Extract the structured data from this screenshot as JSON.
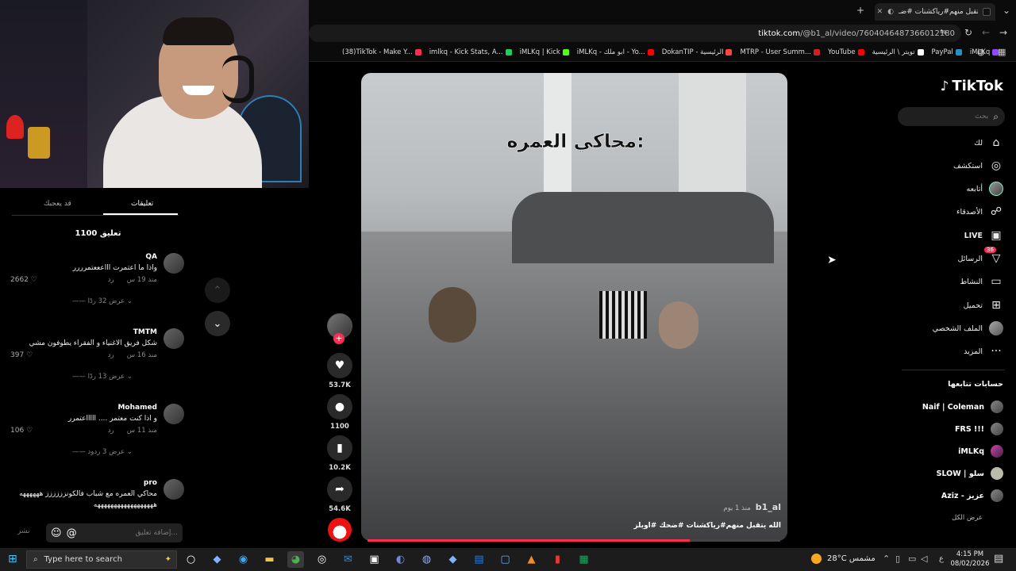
{
  "browser": {
    "tab_title": "الله يتقبل منهم#رياكشنات #ضـ",
    "url_domain": "tiktok.com",
    "url_path": "/@b1_al/video/7604046487366012180",
    "bookmarks": [
      {
        "label": "(38)TikTok - Make Y...",
        "color": "#fe2c55"
      },
      {
        "label": "imlkq - Kick Stats, A...",
        "color": "#1bd15a"
      },
      {
        "label": "iMLKq | Kick",
        "color": "#53fc18"
      },
      {
        "label": "iMLKq - ابو ملك - Yo...",
        "color": "#ff0000"
      },
      {
        "label": "DokanTIP - الرئيسية",
        "color": "#ff4444"
      },
      {
        "label": "MTRP - User Summ...",
        "color": "#cc2222"
      },
      {
        "label": "YouTube",
        "color": "#ff0000"
      },
      {
        "label": "تويتر \\ الرئيسية",
        "color": "#ffffff"
      },
      {
        "label": "PayPal",
        "color": "#2790c3"
      },
      {
        "label": "iMLKq",
        "color": "#9146ff"
      }
    ]
  },
  "comments_panel": {
    "tab_comments": "تعليقات",
    "tab_liked": "قد يعجبك",
    "count_label": "1100 تعليق",
    "comments": [
      {
        "name": "QA",
        "text": "واذا ما اعتمرت اااعععتمرررر",
        "time": "منذ 19 س",
        "reply": "رد",
        "likes": "2662",
        "replies": "عرض 32 ردًا"
      },
      {
        "name": "TMTM",
        "text": "شكل فريق الاغنياء و الفقراء يطوفون مشي",
        "time": "منذ 16 س",
        "reply": "رد",
        "likes": "397",
        "replies": "عرض 13 ردًا"
      },
      {
        "name": "Mohamed",
        "text": "و اذا كنت معتمر .... اااااعتمرر",
        "time": "منذ 11 س",
        "reply": "رد",
        "likes": "106",
        "replies": "عرض 3 ردود"
      },
      {
        "name": "pro",
        "text": "محاكي العمره مع شباب فالكونزززززز ههههههه",
        "text2": "ههههههههههههههههههه",
        "time": "",
        "reply": "",
        "likes": "",
        "replies": ""
      }
    ],
    "input_placeholder": "إضافة تعليق...",
    "post_label": "نشر"
  },
  "video": {
    "overlay_text": "محاكي العمره:",
    "author": "b1_al",
    "posted": "منذ 1 يوم",
    "caption": "الله يتقبل منهم#رياكشنات #ضحك #اويلز",
    "progress": 0.78
  },
  "actions": {
    "likes": "53.7K",
    "comments": "1100",
    "saves": "10.2K",
    "shares": "54.6K"
  },
  "sidebar": {
    "logo": "TikTok",
    "search_placeholder": "بحث",
    "nav": [
      {
        "label": "لك",
        "icon": "home-icon"
      },
      {
        "label": "استكشف",
        "icon": "compass-icon"
      },
      {
        "label": "أتابعه",
        "icon": "following-icon"
      },
      {
        "label": "الأصدقاء",
        "icon": "friends-icon"
      },
      {
        "label": "LIVE",
        "icon": "live-icon"
      },
      {
        "label": "الرسائل",
        "icon": "messages-icon",
        "badge": "36"
      },
      {
        "label": "النشاط",
        "icon": "activity-icon"
      },
      {
        "label": "تحميل",
        "icon": "upload-icon"
      },
      {
        "label": "الملف الشخصي",
        "icon": "profile-icon"
      },
      {
        "label": "المزيد",
        "icon": "more-icon"
      }
    ],
    "following_heading": "حسابات تتابعها",
    "following": [
      "Naif | Coleman",
      "FRS !!!",
      "iMLKq",
      "SLOW | سلو",
      "Aziz - عزيز"
    ],
    "show_all": "عرض الكل"
  },
  "taskbar": {
    "search_placeholder": "Type here to search",
    "weather": "28°C مشمس",
    "time": "4:15 PM",
    "date": "08/02/2026",
    "lang": "ع"
  }
}
